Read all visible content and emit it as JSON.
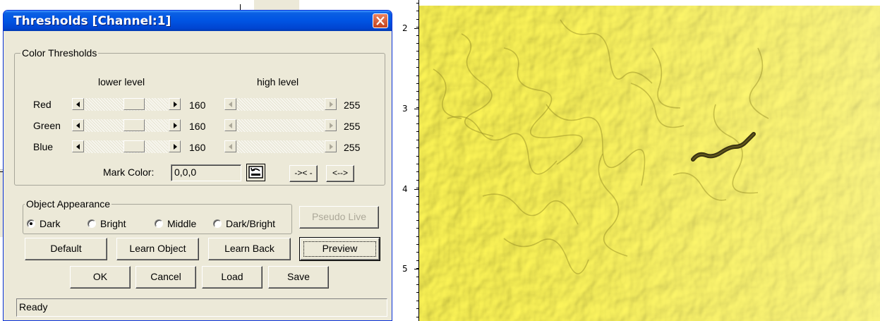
{
  "dialog": {
    "title": "Thresholds [Channel:1]",
    "close_label": "Close"
  },
  "color_thresholds": {
    "group_label": "Color Thresholds",
    "lower_header": "lower level",
    "high_header": "high level",
    "channels": [
      {
        "name": "Red",
        "lower": "160",
        "high": "255",
        "lower_fraction": 0.63,
        "high_fraction": 1.0
      },
      {
        "name": "Green",
        "lower": "160",
        "high": "255",
        "lower_fraction": 0.63,
        "high_fraction": 1.0
      },
      {
        "name": "Blue",
        "lower": "160",
        "high": "255",
        "lower_fraction": 0.63,
        "high_fraction": 1.0
      }
    ],
    "mark_color_label": "Mark Color:",
    "mark_color_value": "0,0,0",
    "collapse_button": "->< -",
    "expand_button": "<-->"
  },
  "object_appearance": {
    "group_label": "Object Appearance",
    "options": [
      {
        "label": "Dark",
        "checked": true
      },
      {
        "label": "Bright",
        "checked": false
      },
      {
        "label": "Middle",
        "checked": false
      },
      {
        "label": "Dark/Bright",
        "checked": false
      }
    ],
    "pseudo_live_label": "Pseudo Live"
  },
  "buttons": {
    "default": "Default",
    "learn_object": "Learn Object",
    "learn_back": "Learn Back",
    "preview": "Preview",
    "ok": "OK",
    "cancel": "Cancel",
    "load": "Load",
    "save": "Save"
  },
  "status": "Ready",
  "ruler": {
    "labels": [
      "2",
      "3",
      "4",
      "5"
    ]
  },
  "colors": {
    "dialog_bg": "#ece9d8",
    "titlebar_blue": "#0054e3",
    "image_yellow": "#f2ea4a"
  }
}
